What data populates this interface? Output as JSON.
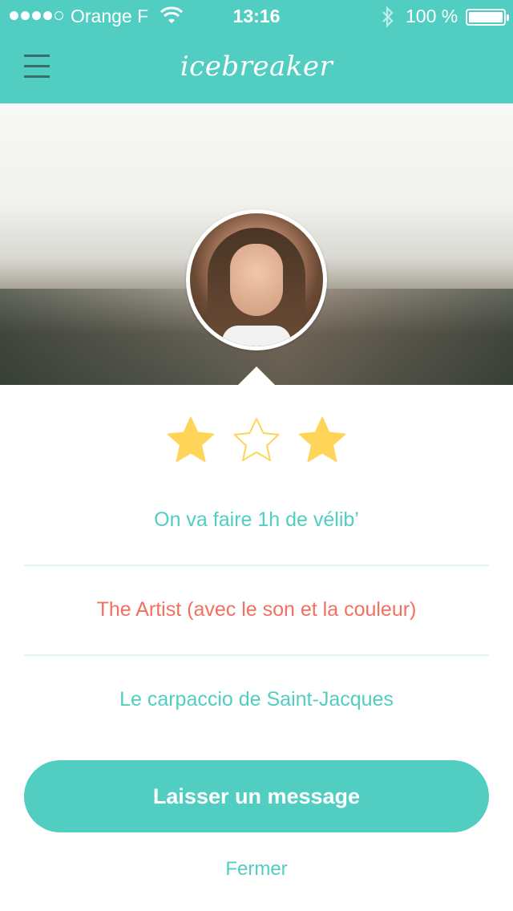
{
  "status_bar": {
    "carrier": "Orange F",
    "time": "13:16",
    "battery": "100 %",
    "signal_bars_filled": 4,
    "signal_bars_total": 5
  },
  "nav": {
    "title": "icebreaker",
    "menu_icon": "hamburger-menu-icon"
  },
  "profile": {
    "photo": "profile-photo"
  },
  "rating": {
    "stars": [
      {
        "state": "filled",
        "icon": "star-filled-icon"
      },
      {
        "state": "empty",
        "icon": "star-outline-icon"
      },
      {
        "state": "filled",
        "icon": "star-filled-icon"
      }
    ],
    "filled_color": "#ffd559"
  },
  "answers": [
    {
      "text": "On va faire 1h de vélib’",
      "color": "#52cdc1"
    },
    {
      "text": "The Artist (avec le son et la couleur)",
      "color": "#f2705f"
    },
    {
      "text": "Le carpaccio de Saint-Jacques",
      "color": "#52cdc1"
    }
  ],
  "actions": {
    "primary_label": "Laisser un message",
    "close_label": "Fermer"
  },
  "colors": {
    "accent": "#52cdc1",
    "highlight": "#f2705f",
    "star": "#ffd559"
  }
}
